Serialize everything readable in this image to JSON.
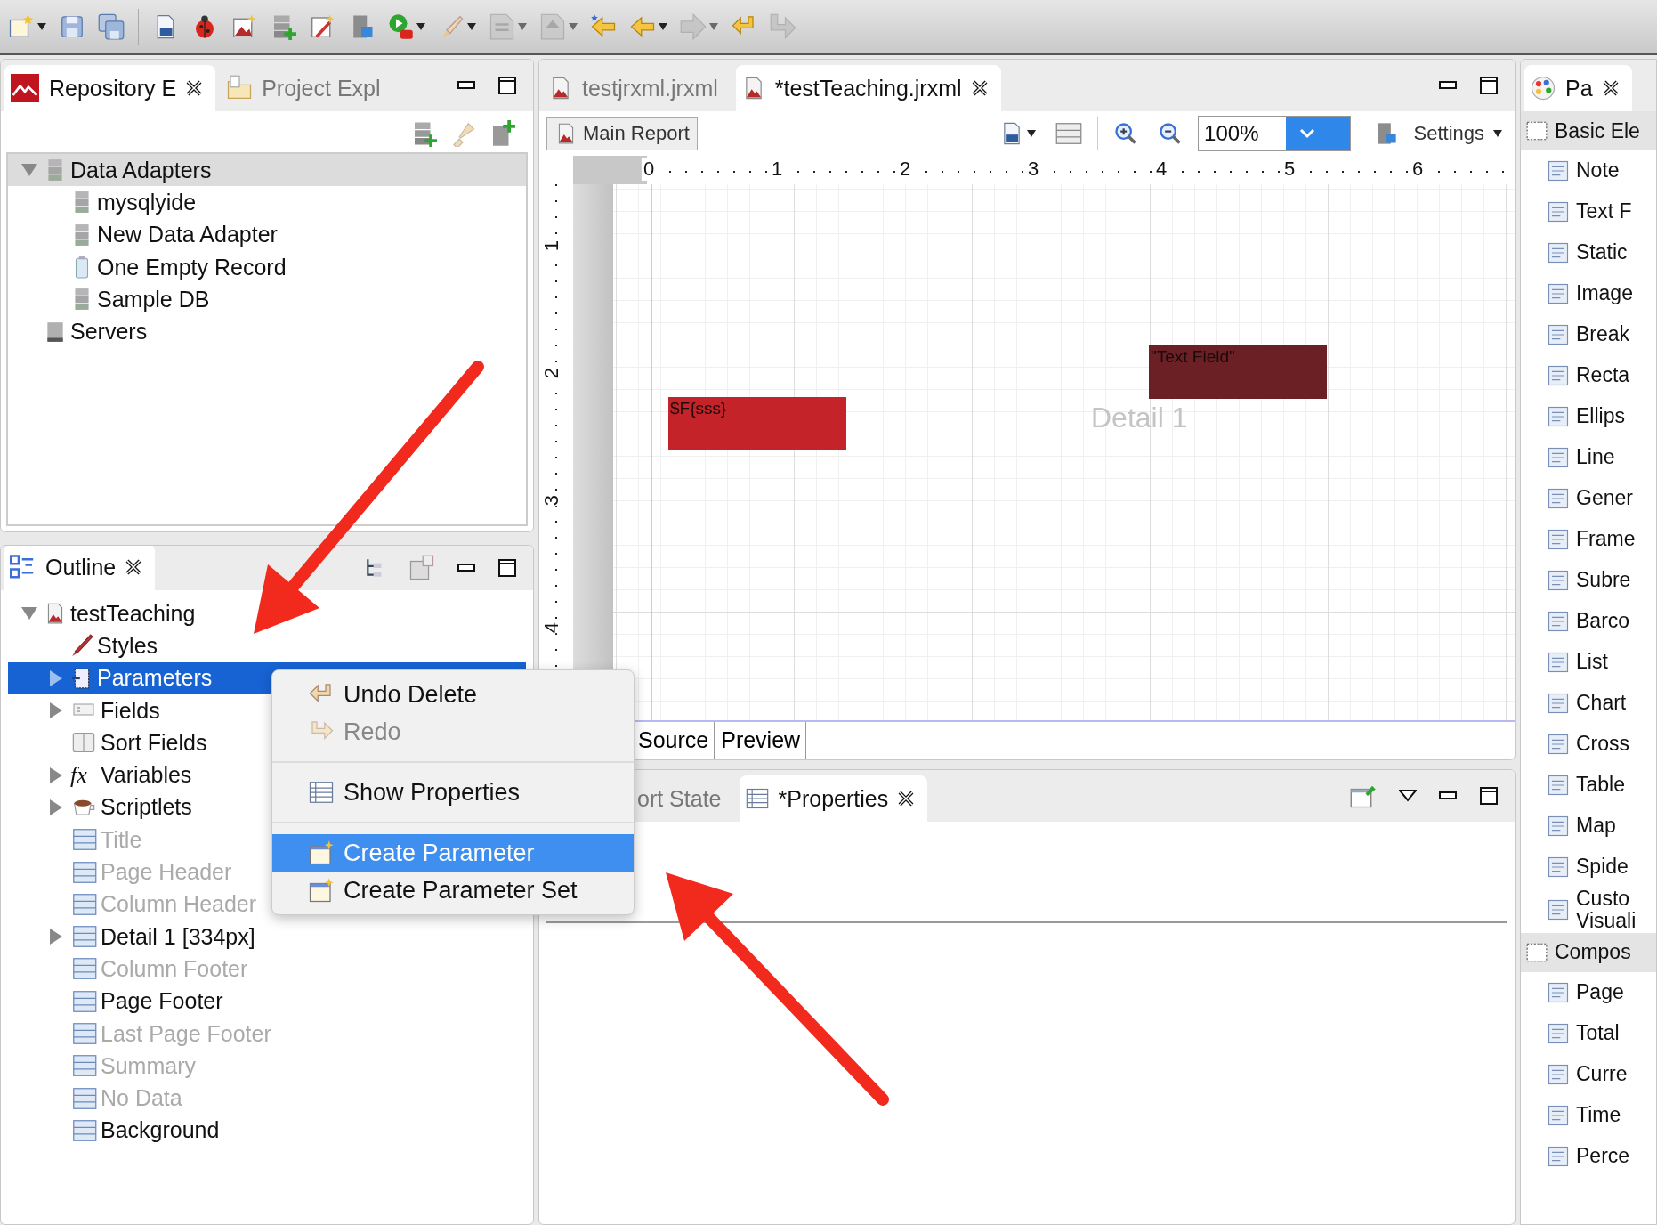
{
  "toolbar": {
    "buttons": [
      {
        "dropdown": true,
        "disabled": false
      },
      {
        "dropdown": false,
        "disabled": false
      },
      {
        "dropdown": false,
        "disabled": false
      },
      {
        "dropdown": false,
        "disabled": false
      },
      {
        "dropdown": false,
        "disabled": false
      },
      {
        "dropdown": false,
        "disabled": false
      },
      {
        "dropdown": false,
        "disabled": false
      },
      {
        "dropdown": false,
        "disabled": false
      },
      {
        "dropdown": false,
        "disabled": false
      },
      {
        "dropdown": true,
        "disabled": false
      },
      {
        "dropdown": true,
        "disabled": false
      },
      {
        "dropdown": true,
        "disabled": true
      },
      {
        "dropdown": true,
        "disabled": true
      },
      {
        "dropdown": false,
        "disabled": false
      },
      {
        "dropdown": true,
        "disabled": false
      },
      {
        "dropdown": true,
        "disabled": true
      },
      {
        "dropdown": false,
        "disabled": false
      },
      {
        "dropdown": false,
        "disabled": true
      }
    ]
  },
  "repository_panel": {
    "tabs": [
      {
        "label": "Repository E",
        "selected": true
      },
      {
        "label": "Project Expl",
        "selected": false
      }
    ],
    "tree": [
      {
        "label": "Data Adapters",
        "kind": "database",
        "expanded": true,
        "selected": true,
        "disabled": false,
        "children": [
          {
            "label": "mysqlyide",
            "kind": "database",
            "selected": false,
            "disabled": false
          },
          {
            "label": "New Data Adapter",
            "kind": "database",
            "selected": false,
            "disabled": false
          },
          {
            "label": "One Empty Record",
            "kind": "container",
            "selected": false,
            "disabled": false
          },
          {
            "label": "Sample DB",
            "kind": "database",
            "selected": false,
            "disabled": false
          }
        ]
      },
      {
        "label": "Servers",
        "kind": "server",
        "selected": false,
        "disabled": false
      }
    ]
  },
  "outline_panel": {
    "tabs": [
      {
        "label": "Outline",
        "selected": true
      }
    ],
    "tree": [
      {
        "label": "testTeaching",
        "kind": "report",
        "expanded": true,
        "selected": false,
        "disabled": false,
        "children": [
          {
            "label": "Styles",
            "kind": "styles",
            "selected": false,
            "disabled": false
          },
          {
            "label": "Parameters",
            "kind": "parameters",
            "expanded": false,
            "selected": true,
            "disabled": false
          },
          {
            "label": "Fields",
            "kind": "fields",
            "expanded": false,
            "selected": false,
            "disabled": false
          },
          {
            "label": "Sort Fields",
            "kind": "sort",
            "selected": false,
            "disabled": false
          },
          {
            "label": "Variables",
            "kind": "variables",
            "icon_text": "fx",
            "expanded": false,
            "selected": false,
            "disabled": false
          },
          {
            "label": "Scriptlets",
            "kind": "scriptlets",
            "expanded": false,
            "selected": false,
            "disabled": false
          },
          {
            "label": "Title",
            "kind": "band",
            "selected": false,
            "disabled": true
          },
          {
            "label": "Page Header",
            "kind": "band",
            "selected": false,
            "disabled": true
          },
          {
            "label": "Column Header",
            "kind": "band",
            "selected": false,
            "disabled": true
          },
          {
            "label": "Detail 1 [334px]",
            "kind": "band",
            "expanded": false,
            "selected": false,
            "disabled": false
          },
          {
            "label": "Column Footer",
            "kind": "band",
            "selected": false,
            "disabled": true
          },
          {
            "label": "Page Footer",
            "kind": "band",
            "selected": false,
            "disabled": false
          },
          {
            "label": "Last Page Footer",
            "kind": "band",
            "selected": false,
            "disabled": true
          },
          {
            "label": "Summary",
            "kind": "band",
            "selected": false,
            "disabled": true
          },
          {
            "label": "No Data",
            "kind": "band",
            "selected": false,
            "disabled": true
          },
          {
            "label": "Background",
            "kind": "band",
            "selected": false,
            "disabled": false
          }
        ]
      }
    ]
  },
  "context_menu": {
    "items": [
      {
        "kind": "item",
        "label": "Undo Delete",
        "disabled": false,
        "selected": false
      },
      {
        "kind": "item",
        "label": "Redo",
        "disabled": true,
        "selected": false
      },
      {
        "kind": "separator"
      },
      {
        "kind": "item",
        "label": "Show Properties",
        "disabled": false,
        "selected": false
      },
      {
        "kind": "separator"
      },
      {
        "kind": "item",
        "label": "Create Parameter",
        "disabled": false,
        "selected": true
      },
      {
        "kind": "item",
        "label": "Create Parameter Set",
        "disabled": false,
        "selected": false
      }
    ]
  },
  "editor": {
    "tabs": [
      {
        "label": "testjrxml.jrxml",
        "selected": false
      },
      {
        "label": "*testTeaching.jrxml",
        "selected": true
      }
    ],
    "main_report": "Main Report",
    "zoom": "100%",
    "settings": "Settings",
    "ruler_h": [
      "0",
      "1",
      "2",
      "3",
      "4",
      "5",
      "6"
    ],
    "ruler_v": [
      "1",
      "2",
      "3",
      "4"
    ],
    "band_label": "Detail 1",
    "elements": [
      {
        "text": "$F{sss}",
        "color": "#c4232a"
      },
      {
        "text": "\"Text Field\"",
        "color": "#6a2024"
      }
    ],
    "bottom_tabs": [
      {
        "label": "Source",
        "selected": false
      },
      {
        "label": "Preview",
        "selected": false
      }
    ]
  },
  "properties_panel": {
    "tabs": [
      {
        "label": "ort State",
        "selected": false
      },
      {
        "label": "*Properties",
        "selected": true
      }
    ]
  },
  "palette": {
    "tabs": [
      {
        "label": "Pa",
        "selected": true
      }
    ],
    "items": [
      {
        "kind": "header",
        "label": "Basic Ele"
      },
      {
        "kind": "item",
        "label": "Note"
      },
      {
        "kind": "item",
        "label": "Text F"
      },
      {
        "kind": "item",
        "label": "Static"
      },
      {
        "kind": "item",
        "label": "Image"
      },
      {
        "kind": "item",
        "label": "Break"
      },
      {
        "kind": "item",
        "label": "Recta"
      },
      {
        "kind": "item",
        "label": "Ellips"
      },
      {
        "kind": "item",
        "label": "Line"
      },
      {
        "kind": "item",
        "label": "Gener"
      },
      {
        "kind": "item",
        "label": "Frame"
      },
      {
        "kind": "item",
        "label": "Subre"
      },
      {
        "kind": "item",
        "label": "Barco"
      },
      {
        "kind": "item",
        "label": "List"
      },
      {
        "kind": "item",
        "label": "Chart"
      },
      {
        "kind": "item",
        "label": "Cross"
      },
      {
        "kind": "item",
        "label": "Table"
      },
      {
        "kind": "item",
        "label": "Map"
      },
      {
        "kind": "item",
        "label": "Spide"
      },
      {
        "kind": "item",
        "label": "Custo Visuali"
      },
      {
        "kind": "header",
        "label": "Compos"
      },
      {
        "kind": "item",
        "label": "Page"
      },
      {
        "kind": "item",
        "label": "Total"
      },
      {
        "kind": "item",
        "label": "Curre"
      },
      {
        "kind": "item",
        "label": "Time"
      },
      {
        "kind": "item",
        "label": "Perce"
      }
    ]
  }
}
